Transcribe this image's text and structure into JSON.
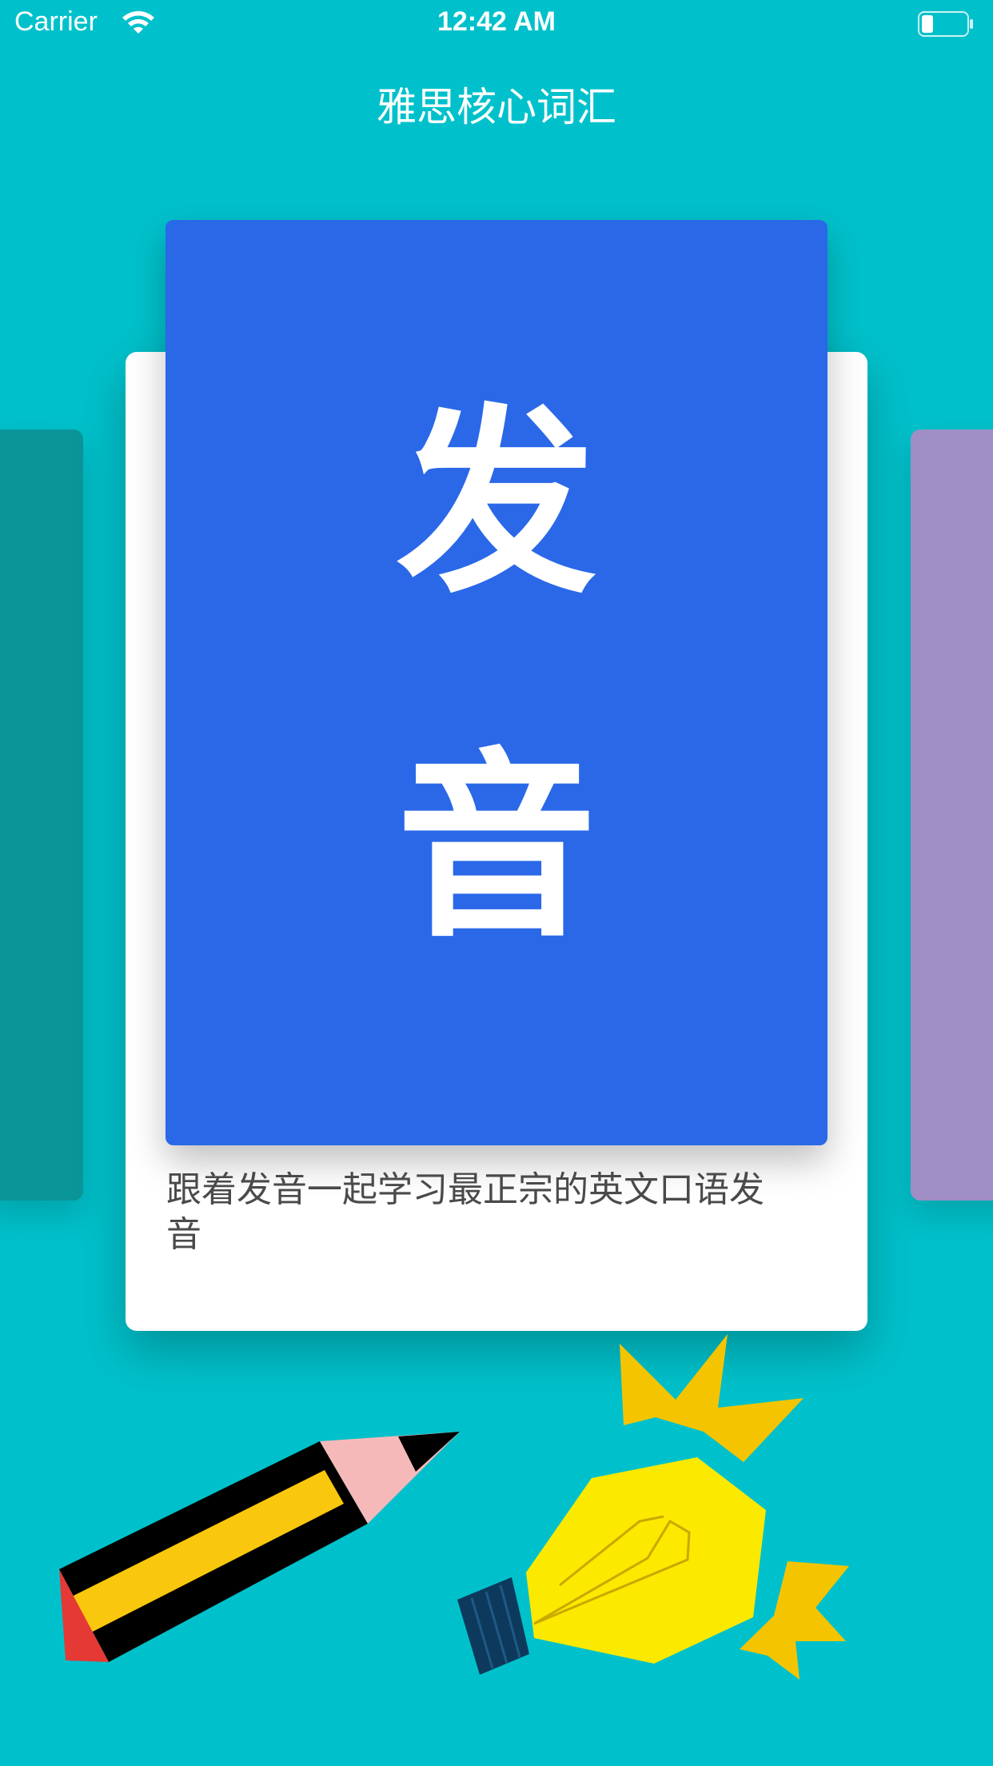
{
  "status_bar": {
    "carrier": "Carrier",
    "time": "12:42 AM",
    "wifi_icon": "wifi-icon",
    "battery_icon": "battery-icon"
  },
  "nav": {
    "title": "雅思核心词汇"
  },
  "carousel": {
    "current_card": {
      "cover_text_1": "发",
      "cover_text_2": "音",
      "description": "跟着发音一起学习最正宗的英文口语发音",
      "cover_color": "#2A68E8"
    },
    "prev_card_color": "#0C9598",
    "next_card_color": "#9F8FC6"
  },
  "colors": {
    "background": "#00C1CB"
  },
  "illustrations": [
    "pencil-icon",
    "lightbulb-icon"
  ]
}
